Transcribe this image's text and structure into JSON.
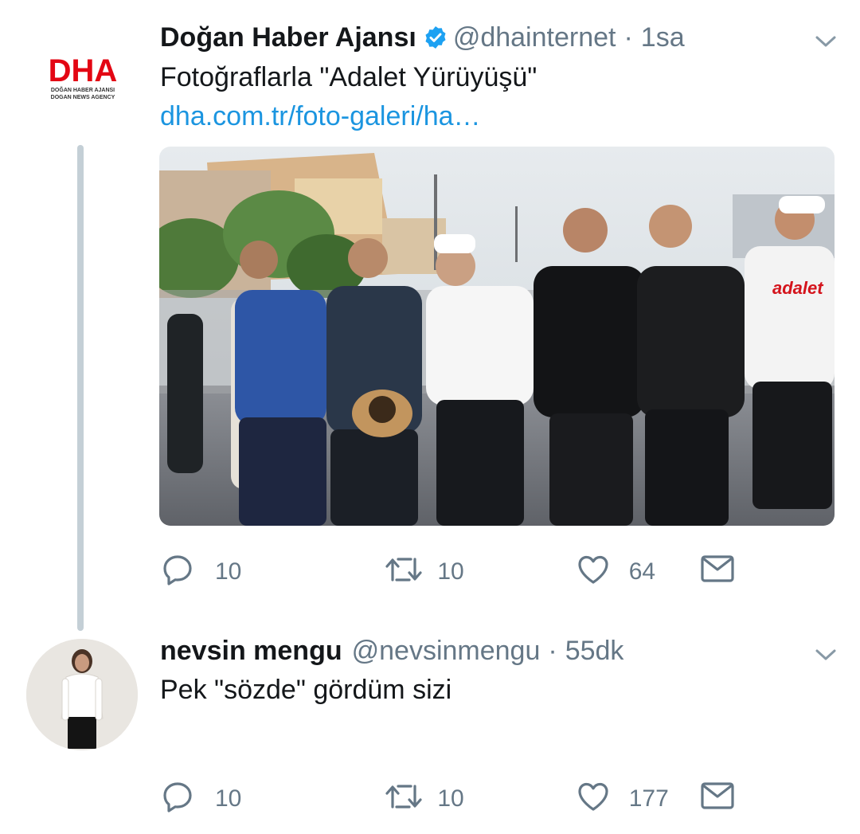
{
  "tweets": [
    {
      "name": "Doğan Haber Ajansı",
      "handle": "@dhainternet",
      "separator": "·",
      "time": "1sa",
      "text": "Fotoğraflarla \"Adalet Yürüyüşü\"",
      "link": "dha.com.tr/foto-galeri/ha…",
      "avatar_logo": "DHA",
      "avatar_sub1": "DOĞAN HABER AJANSI",
      "avatar_sub2": "DOGAN NEWS AGENCY",
      "verified_icon": "verified-badge-icon",
      "photo_caption_visible": "adalet",
      "actions": {
        "reply": "10",
        "retweet": "10",
        "like": "64"
      }
    },
    {
      "name": "nevsin mengu",
      "handle": "@nevsinmengu",
      "separator": "·",
      "time": "55dk",
      "text": "Pek \"sözde\" gördüm sizi",
      "actions": {
        "reply": "10",
        "retweet": "10",
        "like": "177"
      }
    }
  ],
  "colors": {
    "text": "#14171a",
    "secondary": "#657786",
    "link": "#1b95e0",
    "verified": "#1da1f2",
    "thread_line": "#c4cfd6",
    "dha_red": "#e30613"
  },
  "icons": [
    "reply-icon",
    "retweet-icon",
    "like-icon",
    "share-mail-icon",
    "chevron-down-icon"
  ]
}
